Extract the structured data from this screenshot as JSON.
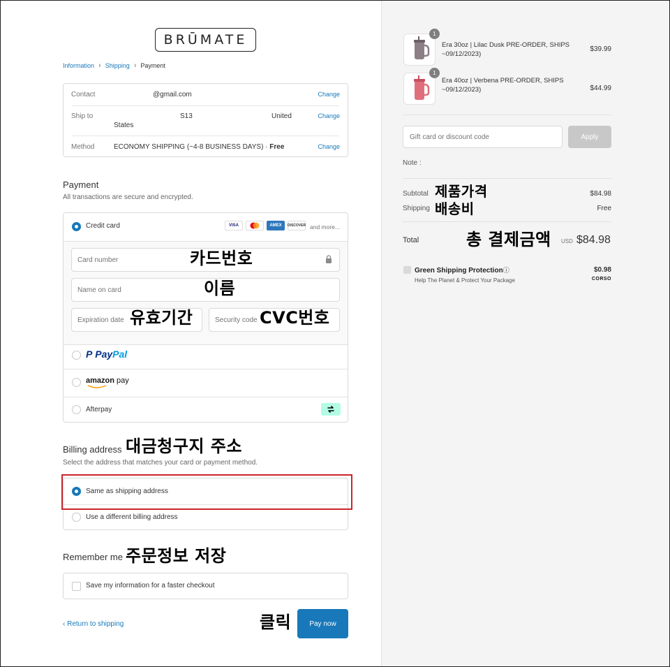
{
  "brand": {
    "logo_text": "BRŪMATE"
  },
  "breadcrumb": {
    "step1": "Information",
    "step2": "Shipping",
    "step3": "Payment"
  },
  "summary": {
    "contact_label": "Contact",
    "contact_value": "@gmail.com",
    "contact_change": "Change",
    "shipto_label": "Ship to",
    "shipto_part1": "S13",
    "shipto_part2": "United",
    "shipto_part3": "States",
    "shipto_change": "Change",
    "method_label": "Method",
    "method_value": "ECONOMY SHIPPING (~4-8 BUSINESS DAYS) · ",
    "method_free": "Free",
    "method_change": "Change"
  },
  "payment": {
    "title": "Payment",
    "subtitle": "All transactions are secure and encrypted.",
    "credit_card_label": "Credit card",
    "card_brands": [
      "VISA",
      "MC",
      "AMEX",
      "DISCOVER"
    ],
    "and_more": "and more...",
    "card_number_placeholder": "Card number",
    "name_placeholder": "Name on card",
    "expiry_placeholder": "Expiration date",
    "security_placeholder": "Security code",
    "paypal_p": "P",
    "paypal_pay": "Pay",
    "paypal_pal": "Pal",
    "amazon_label": "amazon",
    "amazon_pay": "pay",
    "afterpay_label": "Afterpay"
  },
  "billing": {
    "title": "Billing address",
    "subtitle": "Select the address that matches your card or payment method.",
    "same_label": "Same as shipping address",
    "different_label": "Use a different billing address"
  },
  "remember": {
    "title": "Remember me",
    "save_label": "Save my information for a faster checkout"
  },
  "footer": {
    "return_label": "Return to shipping",
    "return_chevron": "‹",
    "pay_now": "Pay now"
  },
  "cart": {
    "items": [
      {
        "qty": "1",
        "name": "Era 30oz | Lilac Dusk PRE-ORDER, SHIPS ~09/12/2023)",
        "price": "$39.99",
        "color": "#8d7f86"
      },
      {
        "qty": "1",
        "name": "Era 40oz | Verbena PRE-ORDER, SHIPS ~09/12/2023)",
        "price": "$44.99",
        "color": "#e06f7c"
      }
    ],
    "gift_placeholder": "Gift card or discount code",
    "apply_label": "Apply",
    "note_label": "Note :",
    "subtotal_label": "Subtotal",
    "subtotal_value": "$84.98",
    "shipping_label": "Shipping",
    "shipping_value": "Free",
    "total_label": "Total",
    "currency": "USD",
    "total_value": "$84.98",
    "protection_title": "Green Shipping Protection",
    "protection_info": "ⓘ",
    "protection_sub": "Help The Planet & Protect Your Package",
    "protection_price": "$0.98",
    "corso_label": "CORSO"
  },
  "annotations": {
    "card_number": "카드번호",
    "name": "이름",
    "expiry": "유효기간",
    "cvc": "CVC번호",
    "billing": "대금청구지 주소",
    "remember": "주문정보 저장",
    "click": "클릭",
    "product_price": "제품가격",
    "shipping_fee": "배송비",
    "total": "총 결제금액"
  },
  "colors": {
    "accent": "#1878b9",
    "highlight": "#c9252c"
  }
}
